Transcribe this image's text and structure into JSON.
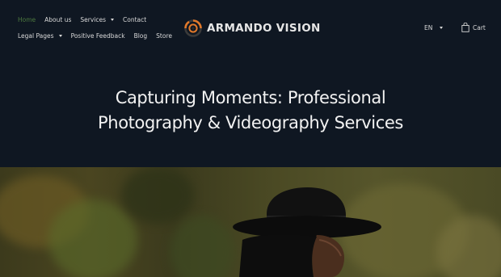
{
  "nav": {
    "row1": [
      {
        "label": "Home",
        "active": true,
        "dropdown": false
      },
      {
        "label": "About us",
        "active": false,
        "dropdown": false
      },
      {
        "label": "Services",
        "active": false,
        "dropdown": true
      },
      {
        "label": "Contact",
        "active": false,
        "dropdown": false
      }
    ],
    "row2": [
      {
        "label": "Legal Pages",
        "dropdown": true
      },
      {
        "label": "Positive Feedback",
        "dropdown": false
      },
      {
        "label": "Blog",
        "dropdown": false
      },
      {
        "label": "Store",
        "dropdown": false
      }
    ]
  },
  "brand": {
    "name": "ARMANDO VISION"
  },
  "language": {
    "selected": "EN"
  },
  "cart": {
    "label": "Cart"
  },
  "hero": {
    "title_line1": "Capturing Moments: Professional",
    "title_line2": "Photography & Videography Services"
  },
  "colors": {
    "background": "#0f1722",
    "active_nav": "#4d7a3f",
    "logo_orange": "#e0782a"
  },
  "icons": {
    "cart": "shopping-bag-icon",
    "logo": "camera-aperture-icon",
    "caret": "caret-down-icon"
  }
}
